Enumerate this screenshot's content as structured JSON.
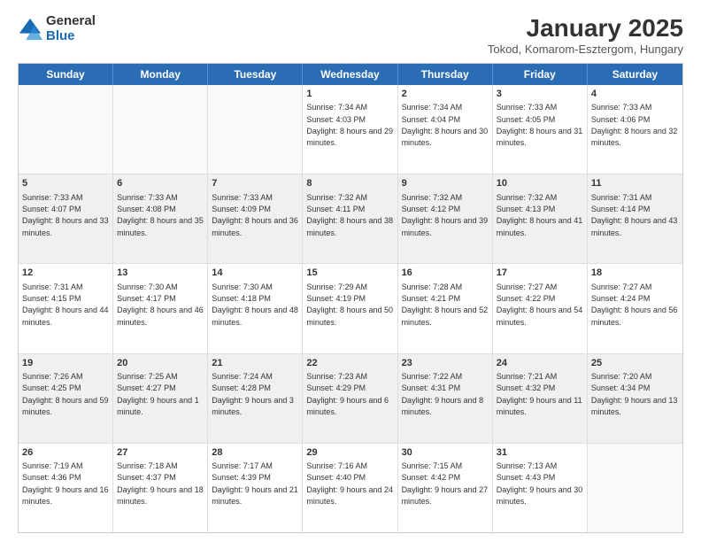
{
  "logo": {
    "general": "General",
    "blue": "Blue"
  },
  "title": "January 2025",
  "location": "Tokod, Komarom-Esztergom, Hungary",
  "days": [
    "Sunday",
    "Monday",
    "Tuesday",
    "Wednesday",
    "Thursday",
    "Friday",
    "Saturday"
  ],
  "rows": [
    [
      {
        "day": "",
        "text": ""
      },
      {
        "day": "",
        "text": ""
      },
      {
        "day": "",
        "text": ""
      },
      {
        "day": "1",
        "text": "Sunrise: 7:34 AM\nSunset: 4:03 PM\nDaylight: 8 hours and 29 minutes."
      },
      {
        "day": "2",
        "text": "Sunrise: 7:34 AM\nSunset: 4:04 PM\nDaylight: 8 hours and 30 minutes."
      },
      {
        "day": "3",
        "text": "Sunrise: 7:33 AM\nSunset: 4:05 PM\nDaylight: 8 hours and 31 minutes."
      },
      {
        "day": "4",
        "text": "Sunrise: 7:33 AM\nSunset: 4:06 PM\nDaylight: 8 hours and 32 minutes."
      }
    ],
    [
      {
        "day": "5",
        "text": "Sunrise: 7:33 AM\nSunset: 4:07 PM\nDaylight: 8 hours and 33 minutes."
      },
      {
        "day": "6",
        "text": "Sunrise: 7:33 AM\nSunset: 4:08 PM\nDaylight: 8 hours and 35 minutes."
      },
      {
        "day": "7",
        "text": "Sunrise: 7:33 AM\nSunset: 4:09 PM\nDaylight: 8 hours and 36 minutes."
      },
      {
        "day": "8",
        "text": "Sunrise: 7:32 AM\nSunset: 4:11 PM\nDaylight: 8 hours and 38 minutes."
      },
      {
        "day": "9",
        "text": "Sunrise: 7:32 AM\nSunset: 4:12 PM\nDaylight: 8 hours and 39 minutes."
      },
      {
        "day": "10",
        "text": "Sunrise: 7:32 AM\nSunset: 4:13 PM\nDaylight: 8 hours and 41 minutes."
      },
      {
        "day": "11",
        "text": "Sunrise: 7:31 AM\nSunset: 4:14 PM\nDaylight: 8 hours and 43 minutes."
      }
    ],
    [
      {
        "day": "12",
        "text": "Sunrise: 7:31 AM\nSunset: 4:15 PM\nDaylight: 8 hours and 44 minutes."
      },
      {
        "day": "13",
        "text": "Sunrise: 7:30 AM\nSunset: 4:17 PM\nDaylight: 8 hours and 46 minutes."
      },
      {
        "day": "14",
        "text": "Sunrise: 7:30 AM\nSunset: 4:18 PM\nDaylight: 8 hours and 48 minutes."
      },
      {
        "day": "15",
        "text": "Sunrise: 7:29 AM\nSunset: 4:19 PM\nDaylight: 8 hours and 50 minutes."
      },
      {
        "day": "16",
        "text": "Sunrise: 7:28 AM\nSunset: 4:21 PM\nDaylight: 8 hours and 52 minutes."
      },
      {
        "day": "17",
        "text": "Sunrise: 7:27 AM\nSunset: 4:22 PM\nDaylight: 8 hours and 54 minutes."
      },
      {
        "day": "18",
        "text": "Sunrise: 7:27 AM\nSunset: 4:24 PM\nDaylight: 8 hours and 56 minutes."
      }
    ],
    [
      {
        "day": "19",
        "text": "Sunrise: 7:26 AM\nSunset: 4:25 PM\nDaylight: 8 hours and 59 minutes."
      },
      {
        "day": "20",
        "text": "Sunrise: 7:25 AM\nSunset: 4:27 PM\nDaylight: 9 hours and 1 minute."
      },
      {
        "day": "21",
        "text": "Sunrise: 7:24 AM\nSunset: 4:28 PM\nDaylight: 9 hours and 3 minutes."
      },
      {
        "day": "22",
        "text": "Sunrise: 7:23 AM\nSunset: 4:29 PM\nDaylight: 9 hours and 6 minutes."
      },
      {
        "day": "23",
        "text": "Sunrise: 7:22 AM\nSunset: 4:31 PM\nDaylight: 9 hours and 8 minutes."
      },
      {
        "day": "24",
        "text": "Sunrise: 7:21 AM\nSunset: 4:32 PM\nDaylight: 9 hours and 11 minutes."
      },
      {
        "day": "25",
        "text": "Sunrise: 7:20 AM\nSunset: 4:34 PM\nDaylight: 9 hours and 13 minutes."
      }
    ],
    [
      {
        "day": "26",
        "text": "Sunrise: 7:19 AM\nSunset: 4:36 PM\nDaylight: 9 hours and 16 minutes."
      },
      {
        "day": "27",
        "text": "Sunrise: 7:18 AM\nSunset: 4:37 PM\nDaylight: 9 hours and 18 minutes."
      },
      {
        "day": "28",
        "text": "Sunrise: 7:17 AM\nSunset: 4:39 PM\nDaylight: 9 hours and 21 minutes."
      },
      {
        "day": "29",
        "text": "Sunrise: 7:16 AM\nSunset: 4:40 PM\nDaylight: 9 hours and 24 minutes."
      },
      {
        "day": "30",
        "text": "Sunrise: 7:15 AM\nSunset: 4:42 PM\nDaylight: 9 hours and 27 minutes."
      },
      {
        "day": "31",
        "text": "Sunrise: 7:13 AM\nSunset: 4:43 PM\nDaylight: 9 hours and 30 minutes."
      },
      {
        "day": "",
        "text": ""
      }
    ]
  ]
}
